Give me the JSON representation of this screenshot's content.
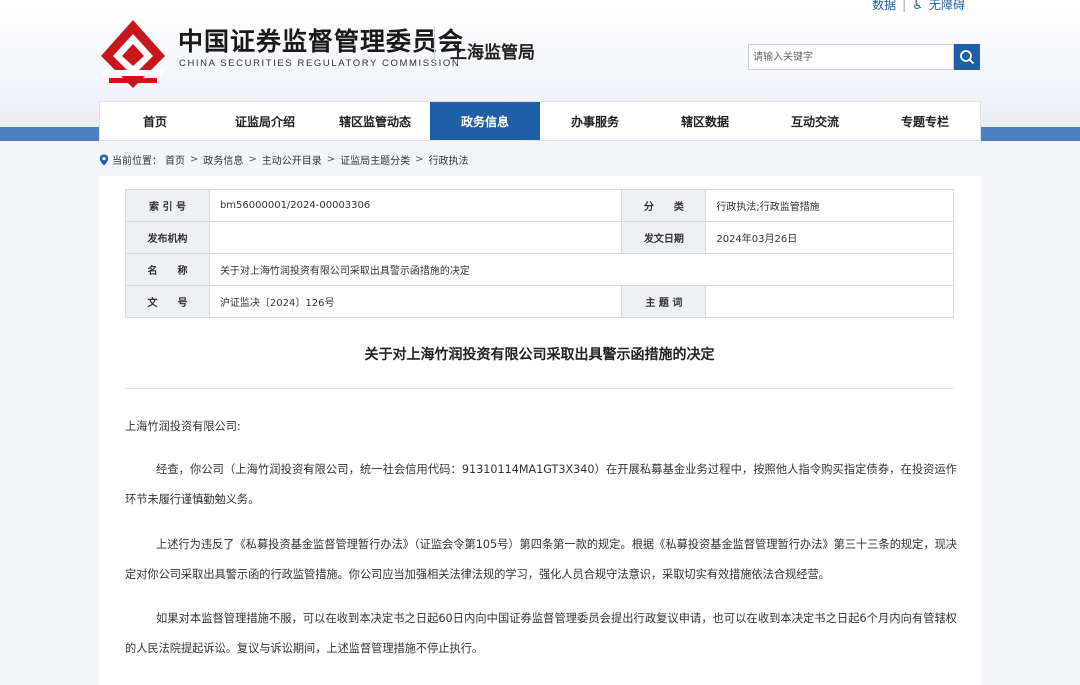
{
  "header": {
    "util_links": [
      "数据",
      "无障碍"
    ],
    "org_name_cn": "中国证券监督管理委员会",
    "org_name_en": "CHINA SECURITIES REGULATORY COMMISSION",
    "bureau": "上海监管局",
    "search_placeholder": "请输入关键字"
  },
  "nav": {
    "items": [
      "首页",
      "证监局介绍",
      "辖区监管动态",
      "政务信息",
      "办事服务",
      "辖区数据",
      "互动交流",
      "专题专栏"
    ],
    "active": "政务信息"
  },
  "breadcrumb": {
    "prefix": "当前位置：",
    "items": [
      "首页",
      "政务信息",
      "主动公开目录",
      "证监局主题分类",
      "行政执法"
    ]
  },
  "meta": {
    "index_label": "索 引 号",
    "index_value": "bm56000001/2024-00003306",
    "category_label": "分　　类",
    "category_value": "行政执法;行政监管措施",
    "publisher_label": "发布机构",
    "publisher_value": "",
    "date_label": "发文日期",
    "date_value": "2024年03月26日",
    "name_label": "名　　称",
    "name_value": "关于对上海竹润投资有限公司采取出具警示函措施的决定",
    "docno_label": "文　　号",
    "docno_value": "沪证监决〔2024〕126号",
    "topic_label": "主 题 词",
    "topic_value": ""
  },
  "article": {
    "title": "关于对上海竹润投资有限公司采取出具警示函措施的决定",
    "greeting": "上海竹润投资有限公司:",
    "paragraphs": [
      "经查，你公司（上海竹润投资有限公司，统一社会信用代码：91310114MA1GT3X340）在开展私募基金业务过程中，按照他人指令购买指定债券，在投资运作环节未履行谨慎勤勉义务。",
      "上述行为违反了《私募投资基金监督管理暂行办法》（证监会令第105号）第四条第一款的规定。根据《私募投资基金监督管理暂行办法》第三十三条的规定，现决定对你公司采取出具警示函的行政监管措施。你公司应当加强相关法律法规的学习，强化人员合规守法意识，采取切实有效措施依法合规经营。",
      "如果对本监督管理措施不服，可以在收到本决定书之日起60日内向中国证券监督管理委员会提出行政复议申请，也可以在收到本决定书之日起6个月内向有管辖权的人民法院提起诉讼。复议与诉讼期间，上述监督管理措施不停止执行。"
    ]
  },
  "colors": {
    "brand_red": "#c8161d",
    "brand_blue": "#1f5fa8"
  }
}
